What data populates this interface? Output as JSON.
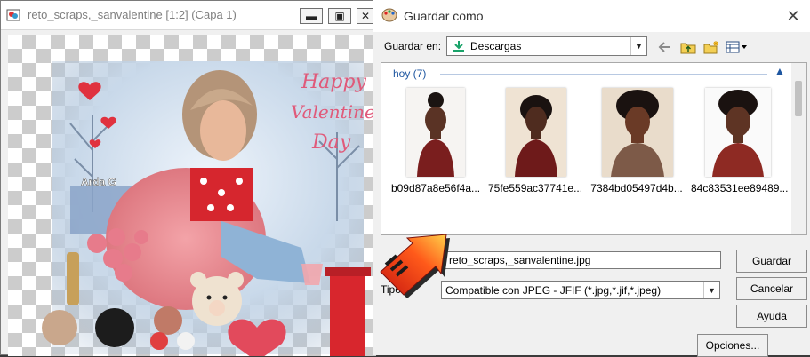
{
  "editor": {
    "title": "reto_scraps,_sanvalentine [1:2] (Capa 1)",
    "artwork_text": [
      "Happy",
      "Valentines",
      "Day"
    ],
    "watermark": "Arda G"
  },
  "dialog": {
    "title": "Guardar como",
    "save_in_label": "Guardar en:",
    "save_in_value": "Descargas",
    "group_header": "hoy (7)",
    "files": [
      {
        "name": "b09d87a8e56f4a..."
      },
      {
        "name": "75fe559ac37741e..."
      },
      {
        "name": "7384bd05497d4b..."
      },
      {
        "name": "84c83531ee89489..."
      }
    ],
    "filename_value": "reto_scraps,_sanvalentine.jpg",
    "type_label": "Tipo:",
    "type_value": "Compatible con JPEG - JFIF (*.jpg,*.jif,*.jpeg)",
    "buttons": {
      "save": "Guardar",
      "cancel": "Cancelar",
      "help": "Ayuda",
      "options": "Opciones..."
    }
  },
  "colors": {
    "accent_blue": "#1e56a0",
    "arrow_red": "#e22a0e",
    "artwork_pink": "#e05a7a"
  },
  "icons": [
    "app-icon",
    "minimize-icon",
    "restore-icon",
    "close-icon",
    "folder-download-icon",
    "back-arrow-icon",
    "up-folder-icon",
    "new-folder-icon",
    "view-menu-icon",
    "pointer-arrow-icon"
  ]
}
